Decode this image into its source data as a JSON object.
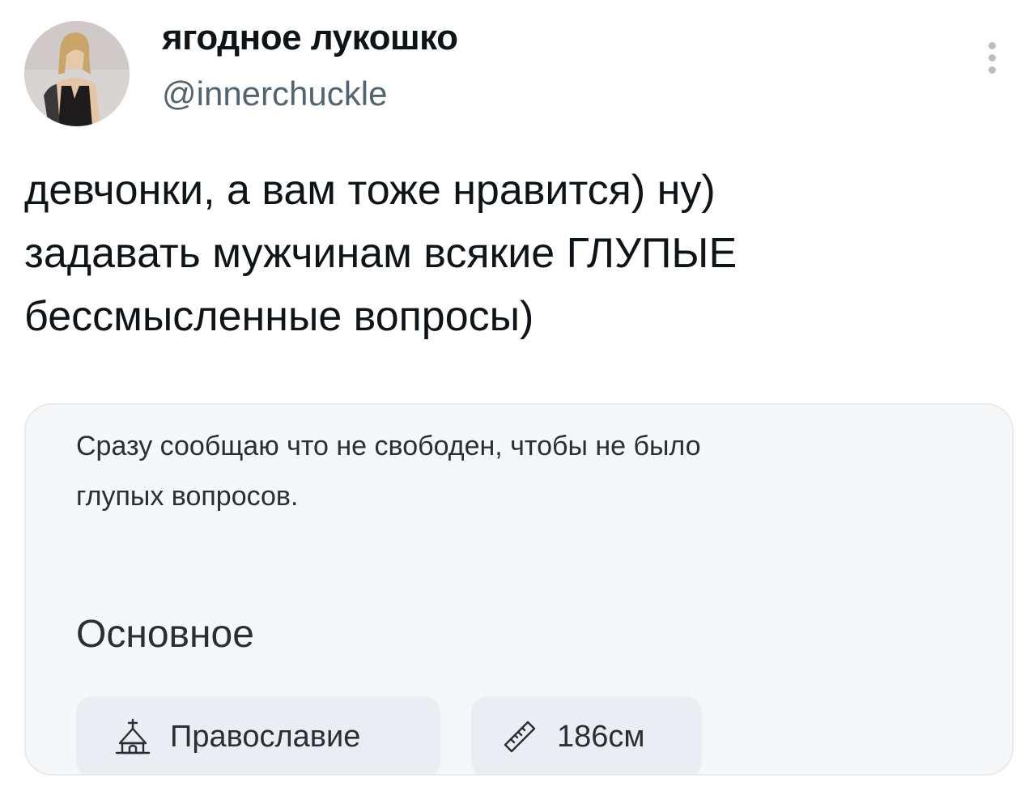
{
  "author": {
    "display_name": "ягодное лукошко",
    "handle": "@innerchuckle"
  },
  "tweet": {
    "lines": [
      "девчонки, а вам тоже нравится) ну)",
      "задавать мужчинам всякие ГЛУПЫЕ",
      "бессмысленные вопросы)"
    ]
  },
  "quoted_profile": {
    "description_lines": [
      "Сразу сообщаю что не свободен, чтобы не было",
      "глупых вопросов."
    ],
    "section_title": "Основное",
    "chips": [
      {
        "icon": "church-icon",
        "label": "Православие"
      },
      {
        "icon": "ruler-icon",
        "label": "186см"
      }
    ]
  },
  "colors": {
    "text_primary": "#0f1419",
    "text_secondary": "#536471",
    "card_bg": "#f6f7f9",
    "card_border": "#e7ebee",
    "chip_bg": "#ebedf2"
  }
}
